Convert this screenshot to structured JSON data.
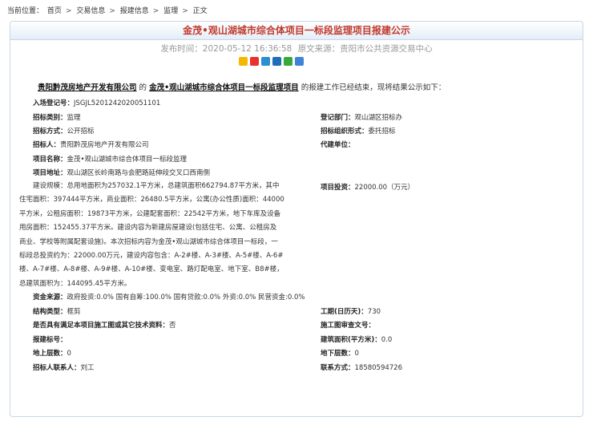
{
  "breadcrumb": {
    "label": "当前位置：",
    "items": [
      "首页",
      "交易信息",
      "报建信息",
      "监理",
      "正文"
    ],
    "separator": ">"
  },
  "title": "金茂•观山湖城市综合体项目一标段监理项目报建公示",
  "meta": {
    "publish": "发布时间：2020-05-12 16:36:58",
    "source": "原文来源：贵阳市公共资源交易中心"
  },
  "share_icons": [
    {
      "name": "qzone-icon",
      "color": "#f5b800"
    },
    {
      "name": "weibo-icon",
      "color": "#e8322d"
    },
    {
      "name": "tencent-weibo-icon",
      "color": "#2b8fd5"
    },
    {
      "name": "renren-icon",
      "color": "#1e6fb8"
    },
    {
      "name": "wechat-icon",
      "color": "#3aa83a"
    },
    {
      "name": "more-share-icon",
      "color": "#3f83d6"
    }
  ],
  "intro": {
    "company": "贵阳黔茂房地产开发有限公司",
    "de": "的",
    "project": "金茂•观山湖城市综合体项目一标段监理项目",
    "rest": "的报建工作已经结束，现将结果公示如下："
  },
  "fields": {
    "reg_no_label": "入场登记号：",
    "reg_no": "JSGJL5201242020051101",
    "category_label": "招标类别：",
    "category": "监理",
    "dept_label": "登记部门：",
    "dept": "观山湖区招标办",
    "method_label": "招标方式：",
    "method": "公开招标",
    "org_form_label": "招标组织形式：",
    "org_form": "委托招标",
    "tenderer_label": "招标人：",
    "tenderer": "贵阳黔茂房地产开发有限公司",
    "agent_label": "代建单位：",
    "agent": "",
    "project_label": "项目名称：",
    "project": "金茂•观山湖城市综合体项目一标段监理",
    "address_label": "项目地址：",
    "address": "观山湖区长岭南路与会肥路延伸段交叉口西南侧",
    "invest_label": "项目投资：",
    "invest": "22000.00（万元）",
    "scale_lines": [
      "建设规模：总用地面积为257032.1平方米，总建筑面积662794.87平方米，其中",
      "住宅面积：397444平方米，商业面积：26480.5平方米，公寓(办公性质)面积：44000",
      "平方米，公租房面积：19873平方米，公建配套面积：22542平方米，地下车库及设备",
      "用房面积：152455.37平方米。建设内容为新建房屋建设(包括住宅、公寓、公租房及",
      "商业、学校等附属配套设施)。本次招标内容为金茂•观山湖城市综合体项目一标段，一",
      "标段总投资约为：22000.00万元，建设内容包含：A-2#楼、A-3#楼、A-5#楼、A-6#",
      "楼、A-7#楼、A-8#楼、A-9#楼、A-10#楼、变电室、路灯配电室、地下室、B8#楼，",
      "总建筑面积为：144095.45平方米。"
    ],
    "fund_label": "资金来源：",
    "fund": "政府投资:0.0% 国有自筹:100.0% 国有贷款:0.0% 外资:0.0% 民营资金:0.0%",
    "structure_label": "结构类型：",
    "structure": "框剪",
    "duration_label": "工期(日历天)：",
    "duration": "730",
    "conditions_label": "是否具有满足本项目施工图或其它技术资料：",
    "conditions": "否",
    "drawing_label": "施工图审查文号：",
    "drawing": "",
    "approval_label": "报建标号：",
    "approval": "",
    "area_label": "建筑面积(平方米)：",
    "area": "0.0",
    "floors_up_label": "地上层数：",
    "floors_up": "0",
    "floors_down_label": "地下层数：",
    "floors_down": "0",
    "contact_label": "招标人联系人：",
    "contact": "刘工",
    "phone_label": "联系方式：",
    "phone": "18580594726"
  }
}
